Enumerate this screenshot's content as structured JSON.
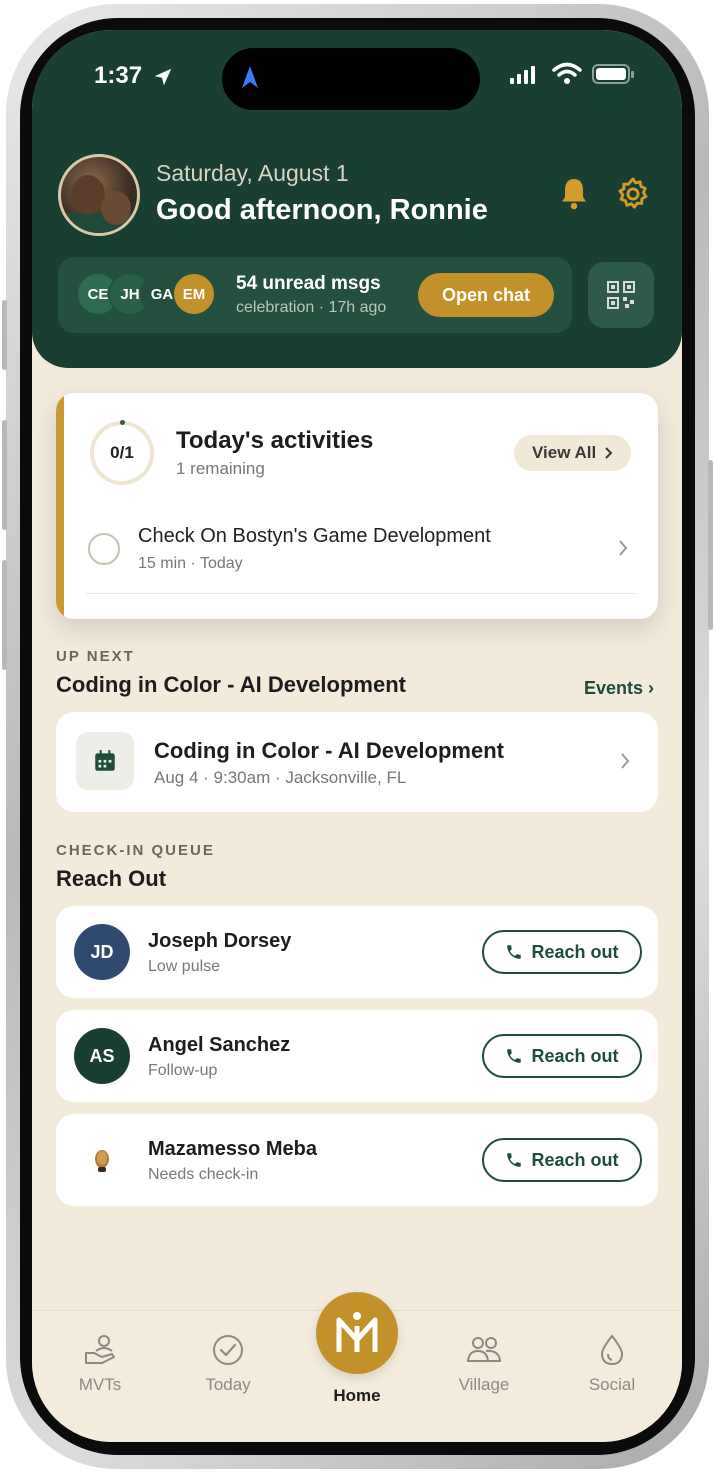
{
  "status_bar": {
    "time": "1:37"
  },
  "header": {
    "date": "Saturday, August 1",
    "greeting": "Good afternoon, Ronnie"
  },
  "chat": {
    "participants": [
      "CE",
      "JH",
      "GA",
      "EM"
    ],
    "unread": "54 unread msgs",
    "meta": "celebration · 17h ago",
    "button": "Open chat"
  },
  "activities": {
    "progress": "0/1",
    "progress_fraction": 0,
    "title": "Today's activities",
    "remaining": "1 remaining",
    "view_all": "View All",
    "tasks": [
      {
        "title": "Check On Bostyn's Game Development",
        "meta": "15 min · Today"
      }
    ]
  },
  "up_next": {
    "eyebrow": "UP NEXT",
    "title": "Coding in Color - AI Development",
    "link": "Events",
    "event": {
      "title": "Coding in Color - AI Development",
      "meta": "Aug 4 · 9:30am · Jacksonville, FL"
    }
  },
  "queue": {
    "eyebrow": "CHECK-IN QUEUE",
    "title": "Reach Out",
    "people": [
      {
        "initials": "JD",
        "name": "Joseph Dorsey",
        "reason": "Low pulse",
        "action": "Reach out",
        "color": "#2f4a6e"
      },
      {
        "initials": "AS",
        "name": "Angel Sanchez",
        "reason": "Follow-up",
        "action": "Reach out",
        "color": "#183f32"
      },
      {
        "initials": "",
        "name": "Mazamesso Meba",
        "reason": "Needs check-in",
        "action": "Reach out",
        "color": "#ffffff"
      }
    ]
  },
  "tabs": [
    {
      "label": "MVTs",
      "icon": "hand-person-icon"
    },
    {
      "label": "Today",
      "icon": "check-circle-icon"
    },
    {
      "label": "Home",
      "icon": "home-logo-icon"
    },
    {
      "label": "Village",
      "icon": "people-icon"
    },
    {
      "label": "Social",
      "icon": "drop-icon"
    }
  ],
  "colors": {
    "header_green": "#183f32",
    "accent_gold": "#c2912a",
    "background": "#f2eadb"
  }
}
